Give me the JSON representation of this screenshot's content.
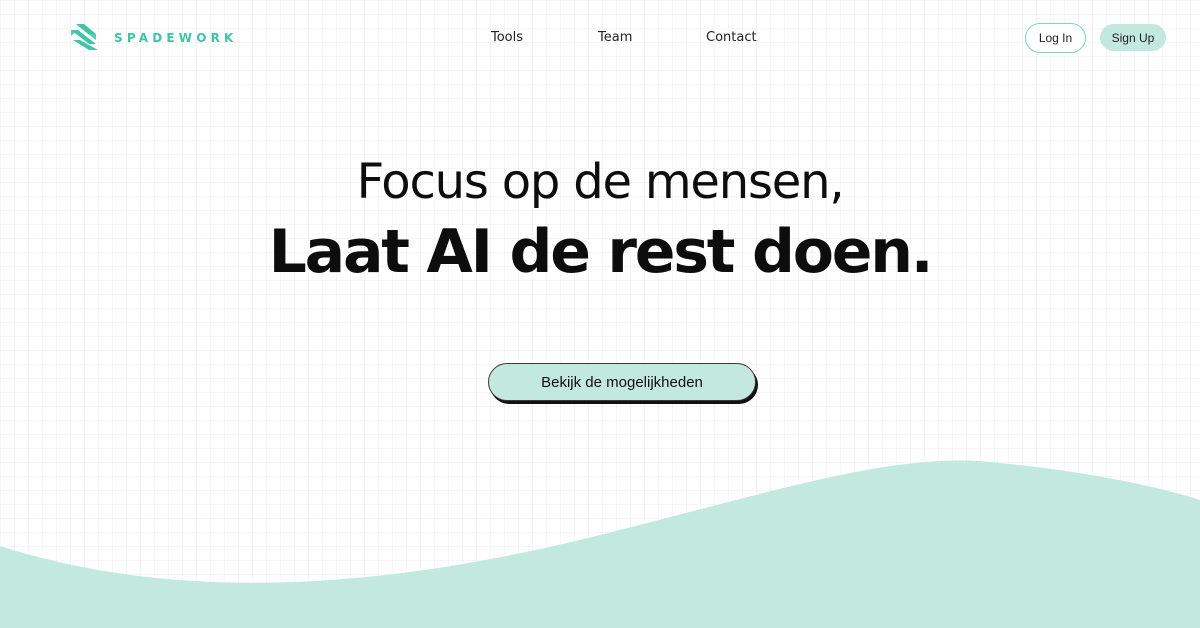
{
  "brand": {
    "name": "SPADEWORK",
    "logo_icon": "spadework-s-logo-icon",
    "color": "#3fc4a8"
  },
  "nav": {
    "items": [
      {
        "label": "Tools"
      },
      {
        "label": "Team"
      },
      {
        "label": "Contact"
      }
    ]
  },
  "auth": {
    "login_label": "Log In",
    "signup_label": "Sign Up"
  },
  "hero": {
    "line1": "Focus op de mensen,",
    "line2": "Laat AI de rest doen.",
    "cta_label": "Bekijk de mogelijkheden"
  },
  "colors": {
    "accent_mint": "#c3e9df",
    "accent_teal": "#3fc4a8",
    "text": "#0d0d0d"
  }
}
